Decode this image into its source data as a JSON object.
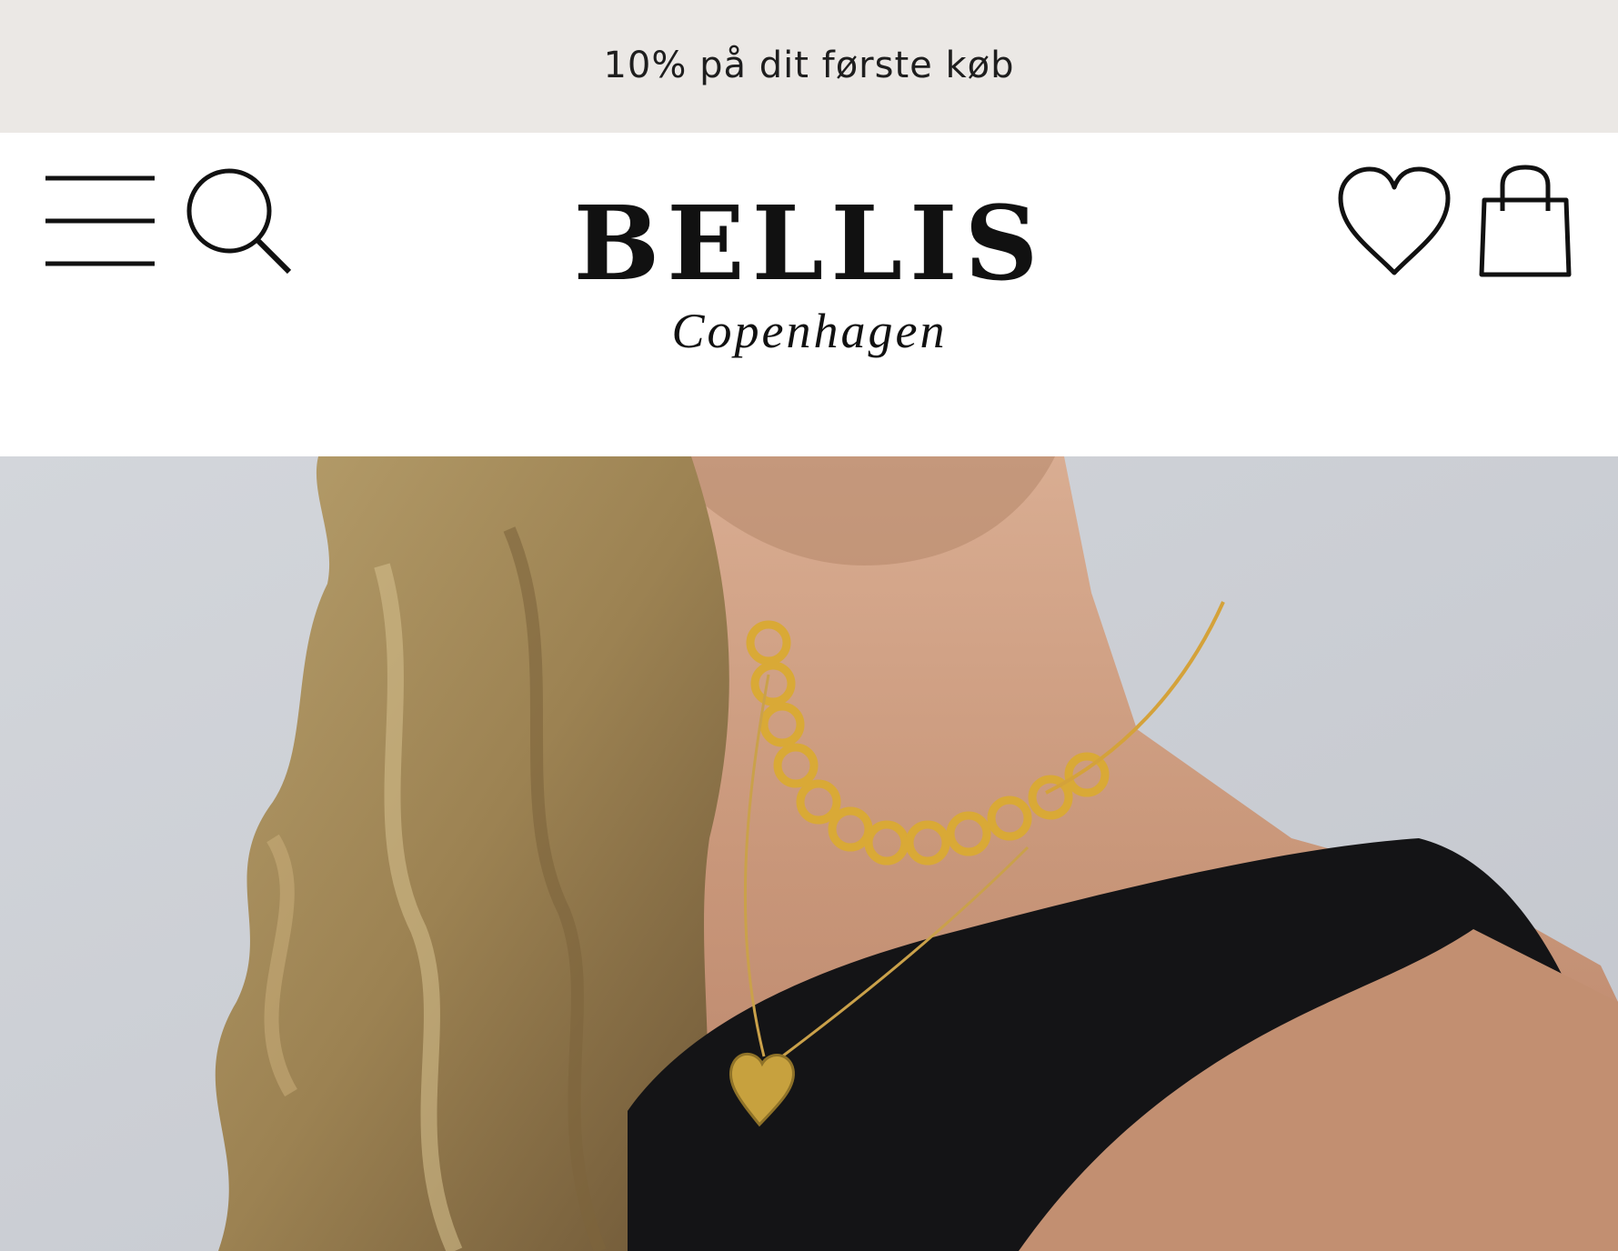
{
  "announcement": {
    "text": "10% på dit første køb"
  },
  "header": {
    "menu_icon": "hamburger-menu-icon",
    "search_icon": "search-icon",
    "wishlist_icon": "heart-icon",
    "cart_icon": "shopping-bag-icon",
    "logo": {
      "brand": "BELLIS",
      "subtitle": "Copenhagen"
    }
  },
  "hero": {
    "image": "photo of woman wearing gold chain necklace and heart pendant",
    "colors": {
      "background": "#cfd2d8",
      "skin": "#c99a7e",
      "hair": "#a9915f",
      "top": "#121214",
      "gold": "#d8a834"
    }
  },
  "colors": {
    "announcement_bg": "#ebe8e5",
    "text": "#111111",
    "header_bg": "#ffffff"
  }
}
